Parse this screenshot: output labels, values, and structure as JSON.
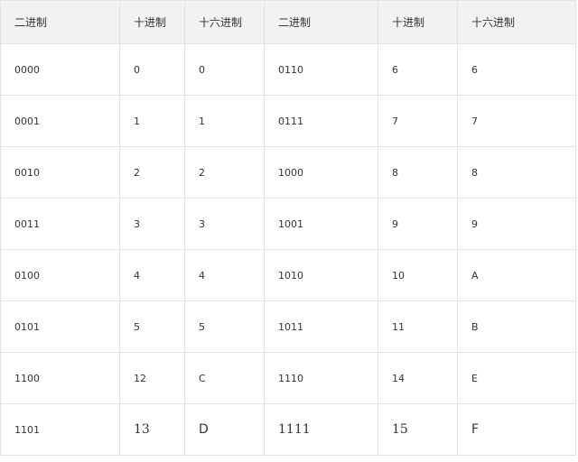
{
  "table": {
    "headers": [
      "二进制",
      "十进制",
      "十六进制",
      "二进制",
      "十进制",
      "十六进制"
    ],
    "rows": [
      [
        "0000",
        "0",
        "0",
        "0110",
        "6",
        "6"
      ],
      [
        "0001",
        "1",
        "1",
        "0111",
        "7",
        "7"
      ],
      [
        "0010",
        "2",
        "2",
        "1000",
        "8",
        "8"
      ],
      [
        "0011",
        "3",
        "3",
        "1001",
        "9",
        "9"
      ],
      [
        "0100",
        "4",
        "4",
        "1010",
        "10",
        "A"
      ],
      [
        "0101",
        "5",
        "5",
        "1011",
        "11",
        "B"
      ],
      [
        "1100",
        "12",
        "C",
        "1110",
        "14",
        "E"
      ],
      [
        "1101",
        "13",
        "D",
        "1111",
        "15",
        "F"
      ]
    ]
  },
  "colors": {
    "header_background": "#f2f2f2",
    "border": "#e3e3e3",
    "text": "#333333"
  }
}
